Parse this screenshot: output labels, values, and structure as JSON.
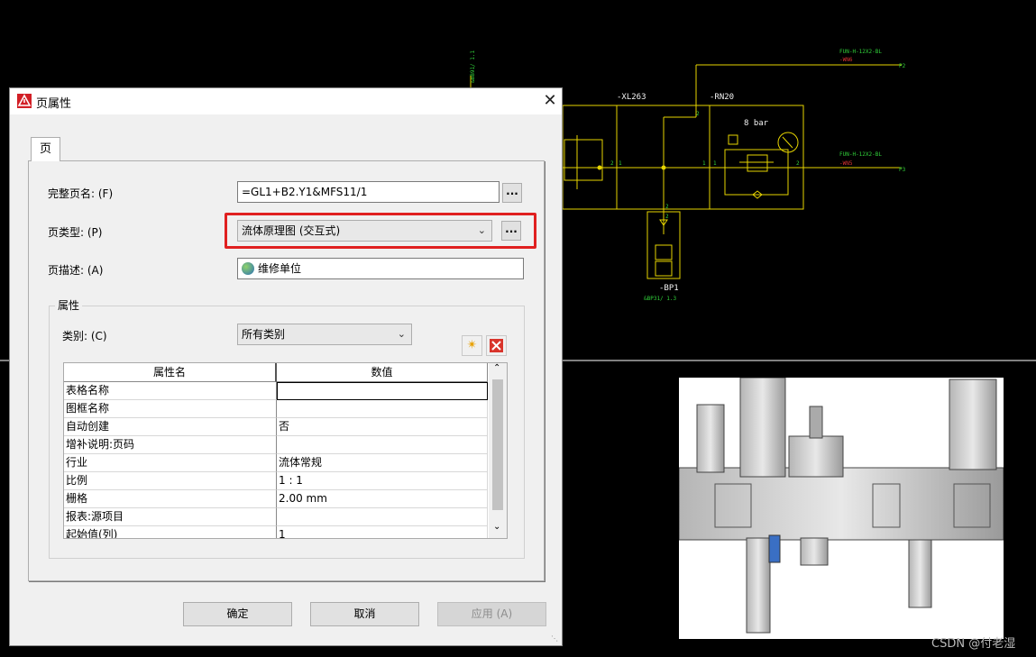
{
  "schematic": {
    "labels": {
      "xl263": "-XL263",
      "rn20": "-RN20",
      "pressure": "8 bar",
      "bp1": "-BP1",
      "bp1_ref": "&BP31/ 1.3",
      "top_ref": "&BB91/ 1.1",
      "wn6_part": "FUN-H-12X2-BL",
      "wn6": "-WN6",
      "wn5_part": "FUN-H-12X2-BL",
      "wn5": "-WN5",
      "p2": "P2",
      "p3": "P3",
      "pin1a": "1",
      "pin2a": "2",
      "pin1b": "1",
      "pin2b": "2",
      "pin1c": "1",
      "pin2c": "2",
      "pin2d": "2",
      "pin2e": "2"
    }
  },
  "dialog": {
    "title": "页属性",
    "close": "✕",
    "tab": "页",
    "full_page_name_label": "完整页名: (F)",
    "full_page_name_value": "=GL1+B2.Y1&MFS11/1",
    "page_type_label": "页类型: (P)",
    "page_type_value": "流体原理图 (交互式)",
    "page_desc_label": "页描述: (A)",
    "page_desc_value": "维修单位",
    "dots": "...",
    "properties_group": "属性",
    "category_label": "类别: (C)",
    "category_value": "所有类别",
    "grid": {
      "headers": [
        "属性名",
        "数值"
      ],
      "rows": [
        [
          "表格名称",
          ""
        ],
        [
          "图框名称",
          ""
        ],
        [
          "自动创建",
          "否"
        ],
        [
          "增补说明:页码",
          ""
        ],
        [
          "行业",
          "流体常规"
        ],
        [
          "比例",
          "1 : 1"
        ],
        [
          "栅格",
          "2.00 mm"
        ],
        [
          "报表:源项目",
          ""
        ],
        [
          "起始值(列)",
          "1"
        ]
      ]
    },
    "buttons": {
      "ok": "确定",
      "cancel": "取消",
      "apply": "应用 (A)"
    }
  },
  "watermark": "CSDN @付老湿"
}
